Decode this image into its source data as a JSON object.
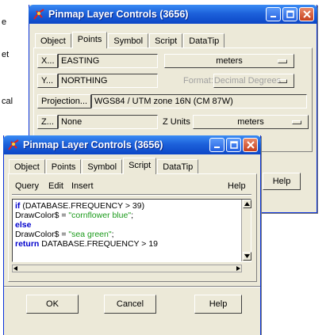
{
  "background_text": [
    "e",
    "et",
    "cal"
  ],
  "back_window": {
    "title": "Pinmap Layer Controls (3656)",
    "tabs": [
      "Object",
      "Points",
      "Symbol",
      "Script",
      "DataTip"
    ],
    "active_tab": "Points",
    "x_button": "X...",
    "x_value": "EASTING",
    "units_value": "meters",
    "y_button": "Y...",
    "y_value": "NORTHING",
    "format_label": "Format:",
    "format_value": "Decimal Degrees",
    "projection_button": "Projection...",
    "projection_value": "WGS84 / UTM zone 16N (CM 87W)",
    "z_button": "Z...",
    "z_value": "None",
    "z_units_label": "Z Units",
    "z_units_value": "meters",
    "help_button": "Help"
  },
  "front_window": {
    "title": "Pinmap Layer Controls (3656)",
    "tabs": [
      "Object",
      "Points",
      "Symbol",
      "Script",
      "DataTip"
    ],
    "active_tab": "Script",
    "menu": {
      "query": "Query",
      "edit": "Edit",
      "insert": "Insert",
      "help": "Help"
    },
    "script_lines": [
      {
        "parts": [
          {
            "t": "if",
            "s": "kw"
          },
          {
            "t": " (DATABASE.FREQUENCY > 39)",
            "s": ""
          }
        ]
      },
      {
        "parts": [
          {
            "t": "DrawColor$ = ",
            "s": ""
          },
          {
            "t": "\"cornflower blue\"",
            "s": "str"
          },
          {
            "t": ";",
            "s": ""
          }
        ]
      },
      {
        "parts": [
          {
            "t": "else",
            "s": "kw"
          }
        ]
      },
      {
        "parts": [
          {
            "t": "DrawColor$ = ",
            "s": ""
          },
          {
            "t": "\"sea green\"",
            "s": "str"
          },
          {
            "t": ";",
            "s": ""
          }
        ]
      },
      {
        "parts": [
          {
            "t": "return",
            "s": "kw"
          },
          {
            "t": " DATABASE.FREQUENCY > 19",
            "s": ""
          }
        ]
      }
    ],
    "ok_button": "OK",
    "cancel_button": "Cancel",
    "help_button": "Help"
  },
  "colors": {
    "titlebar": "#0c46c6",
    "keyword": "#0000cc",
    "string": "#1a9a1a",
    "window_bg": "#ece9d8"
  }
}
